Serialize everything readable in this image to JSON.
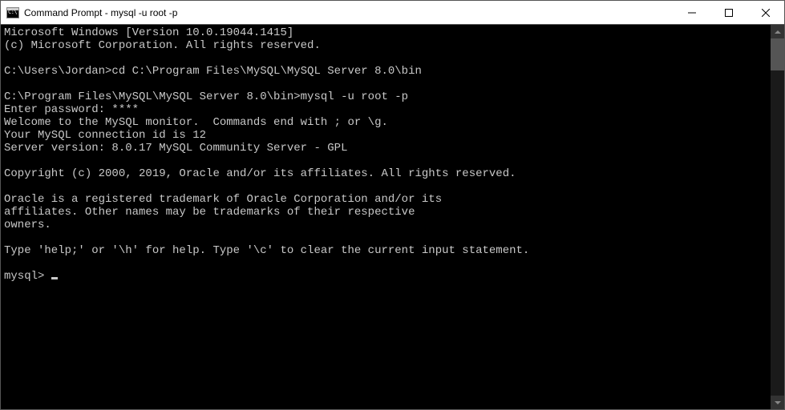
{
  "window": {
    "title": "Command Prompt - mysql  -u root -p"
  },
  "terminal": {
    "lines": [
      "Microsoft Windows [Version 10.0.19044.1415]",
      "(c) Microsoft Corporation. All rights reserved.",
      "",
      "C:\\Users\\Jordan>cd C:\\Program Files\\MySQL\\MySQL Server 8.0\\bin",
      "",
      "C:\\Program Files\\MySQL\\MySQL Server 8.0\\bin>mysql -u root -p",
      "Enter password: ****",
      "Welcome to the MySQL monitor.  Commands end with ; or \\g.",
      "Your MySQL connection id is 12",
      "Server version: 8.0.17 MySQL Community Server - GPL",
      "",
      "Copyright (c) 2000, 2019, Oracle and/or its affiliates. All rights reserved.",
      "",
      "Oracle is a registered trademark of Oracle Corporation and/or its",
      "affiliates. Other names may be trademarks of their respective",
      "owners.",
      "",
      "Type 'help;' or '\\h' for help. Type '\\c' to clear the current input statement.",
      ""
    ],
    "prompt": "mysql> "
  }
}
